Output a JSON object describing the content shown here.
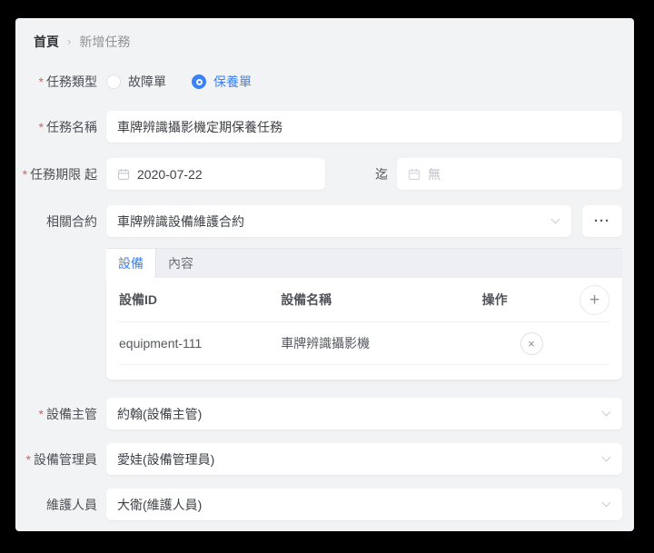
{
  "breadcrumb": {
    "home": "首頁",
    "separator": "›",
    "current": "新增任務"
  },
  "required_marker": "*",
  "form": {
    "task_type": {
      "label": "任務類型",
      "required": true,
      "options": [
        {
          "label": "故障單",
          "selected": false
        },
        {
          "label": "保養單",
          "selected": true
        }
      ]
    },
    "task_name": {
      "label": "任務名稱",
      "required": true,
      "value": "車牌辨識攝影機定期保養任務"
    },
    "task_deadline": {
      "label": "任務期限 起",
      "required": true,
      "start_value": "2020-07-22",
      "end_label": "迄",
      "end_placeholder": "無"
    },
    "related_contract": {
      "label": "相關合約",
      "required": false,
      "value": "車牌辨識設備維護合約",
      "more_button_label": "···"
    },
    "equipment_supervisor": {
      "label": "設備主管",
      "required": true,
      "value": "約翰(設備主管)"
    },
    "equipment_admin": {
      "label": "設備管理員",
      "required": true,
      "value": "愛娃(設備管理員)"
    },
    "maintenance_staff": {
      "label": "維護人員",
      "required": false,
      "value": "大衛(維護人員)"
    }
  },
  "tabs": [
    {
      "label": "設備",
      "active": true
    },
    {
      "label": "內容",
      "active": false
    }
  ],
  "equipment_table": {
    "columns": [
      "設備ID",
      "設備名稱",
      "操作"
    ],
    "rows": [
      {
        "id": "equipment-111",
        "name": "車牌辨識攝影機"
      }
    ],
    "add_button_glyph": "+",
    "remove_button_glyph": "×"
  },
  "colors": {
    "accent_blue": "#3b82f6",
    "required_red": "#f5564a",
    "page_bg": "#f2f3f5",
    "outer_bg": "#000000"
  }
}
